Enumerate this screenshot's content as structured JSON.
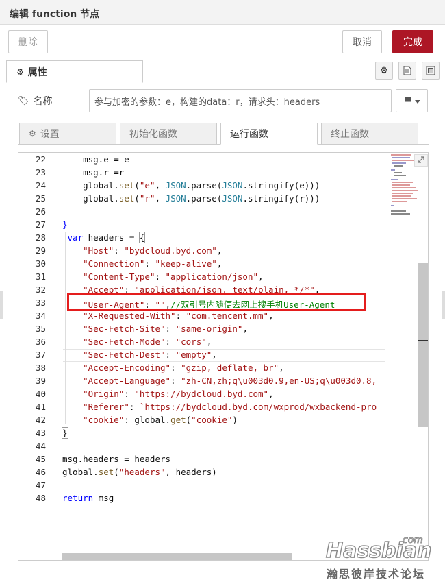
{
  "dialog": {
    "title": "编辑 function 节点",
    "delete_label": "删除",
    "cancel_label": "取消",
    "done_label": "完成",
    "accent_color": "#ad1625"
  },
  "tabs": {
    "properties_label": "属性",
    "properties_icon": "gear-icon",
    "tool_icons": [
      "settings-icon",
      "description-icon",
      "appearance-icon"
    ]
  },
  "name_field": {
    "label": "名称",
    "label_icon": "tag-icon",
    "value": "参与加密的参数：e，构建的data：r，请求头：headers",
    "library_icon": "book-icon"
  },
  "subtabs": [
    {
      "label": "设置",
      "icon": "gear-icon"
    },
    {
      "label": "初始化函数"
    },
    {
      "label": "运行函数"
    },
    {
      "label": "终止函数"
    }
  ],
  "editor": {
    "line_numbers": [
      "22",
      "23",
      "24",
      "25",
      "26",
      "27",
      "28",
      "29",
      "30",
      "31",
      "32",
      "33",
      "34",
      "35",
      "36",
      "37",
      "38",
      "39",
      "40",
      "41",
      "42",
      "43",
      "44",
      "45",
      "46",
      "47",
      "48"
    ],
    "highlight_color": "#e41d1d"
  },
  "watermark": {
    "brand": "Hassbian",
    "suffix": "com",
    "slogan": "瀚思彼岸技术论坛"
  }
}
